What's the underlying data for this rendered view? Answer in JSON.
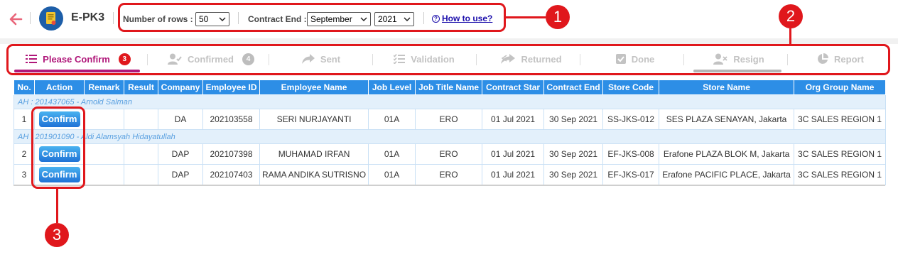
{
  "header": {
    "title": "E-PK3",
    "rows_label": "Number of rows :",
    "rows_value": "50",
    "contract_end_label": "Contract End :",
    "month_value": "September",
    "year_value": "2021",
    "how_to_use": "How to use?"
  },
  "annotations": {
    "one": "1",
    "two": "2",
    "three": "3"
  },
  "tabs": [
    {
      "label": "Please Confirm",
      "badge": "3",
      "icon": "list-icon"
    },
    {
      "label": "Confirmed",
      "badge": "4",
      "icon": "user-check-icon"
    },
    {
      "label": "Sent",
      "icon": "share-arrow-icon"
    },
    {
      "label": "Validation",
      "icon": "checklist-icon"
    },
    {
      "label": "Returned",
      "icon": "forward-arrow-icon"
    },
    {
      "label": "Done",
      "icon": "checkbox-icon"
    },
    {
      "label": "Resign",
      "icon": "user-remove-icon"
    },
    {
      "label": "Report",
      "icon": "pie-chart-icon"
    }
  ],
  "table": {
    "columns": [
      "No.",
      "Action",
      "Remark",
      "Result",
      "Company",
      "Employee ID",
      "Employee Name",
      "Job Level",
      "Job Title Name",
      "Contract Star",
      "Contract End",
      "Store Code",
      "Store Name",
      "Org Group Name"
    ],
    "groups": [
      {
        "label": "AH : 201437065 - Arnold Salman",
        "rows": [
          {
            "no": "1",
            "action": "Confirm",
            "remark": "",
            "result": "",
            "company": "DA",
            "employee_id": "202103558",
            "employee_name": "SERI NURJAYANTI",
            "job_level": "01A",
            "job_title": "ERO",
            "contract_start": "01 Jul 2021",
            "contract_end": "30 Sep 2021",
            "store_code": "SS-JKS-012",
            "store_name": "SES PLAZA SENAYAN, Jakarta",
            "org_group": "3C SALES REGION 1"
          }
        ]
      },
      {
        "label": "AH : 201901090 - Aldi Alamsyah Hidayatullah",
        "rows": [
          {
            "no": "2",
            "action": "Confirm",
            "remark": "",
            "result": "",
            "company": "DAP",
            "employee_id": "202107398",
            "employee_name": "MUHAMAD IRFAN",
            "job_level": "01A",
            "job_title": "ERO",
            "contract_start": "01 Jul 2021",
            "contract_end": "30 Sep 2021",
            "store_code": "EF-JKS-008",
            "store_name": "Erafone PLAZA BLOK M, Jakarta",
            "org_group": "3C SALES REGION 1"
          },
          {
            "no": "3",
            "action": "Confirm",
            "remark": "",
            "result": "",
            "company": "DAP",
            "employee_id": "202107403",
            "employee_name": "RAMA ANDIKA SUTRISNO",
            "job_level": "01A",
            "job_title": "ERO",
            "contract_start": "01 Jul 2021",
            "contract_end": "30 Sep 2021",
            "store_code": "EF-JKS-017",
            "store_name": "Erafone PACIFIC PLACE, Jakarta",
            "org_group": "3C SALES REGION 1"
          }
        ]
      }
    ]
  },
  "colors": {
    "accent": "#b0177a",
    "header_blue": "#2d8ee6",
    "annotation_red": "#e0171c",
    "badge_red": "#e0171c",
    "badge_gray": "#bdbdbd"
  }
}
